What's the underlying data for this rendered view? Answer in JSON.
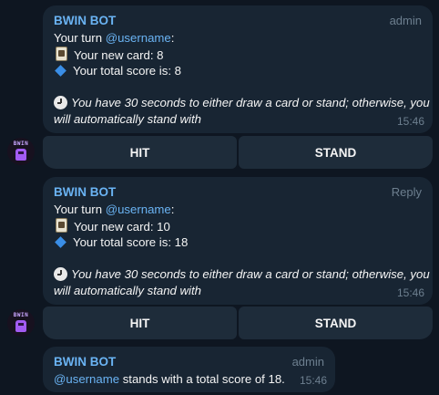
{
  "messages": [
    {
      "sender": "BWIN BOT",
      "role": "admin",
      "turn_prefix": "Your turn ",
      "mention": "@username",
      "turn_suffix": ":",
      "card_line": "Your new card: 8",
      "score_line": "Your total score is: 8",
      "timer_line1": "You have 30 seconds to either draw a card or stand; otherwise, you",
      "timer_line2": "will automatically stand with",
      "time": "15:46"
    },
    {
      "sender": "BWIN BOT",
      "role": "Reply",
      "turn_prefix": "Your turn ",
      "mention": "@username",
      "turn_suffix": ":",
      "card_line": "Your new card: 10",
      "score_line": "Your total score is: 18",
      "timer_line1": "You have 30 seconds to either draw a card or stand; otherwise, you",
      "timer_line2": "will automatically stand with",
      "time": "15:46"
    },
    {
      "sender": "BWIN BOT",
      "role": "admin",
      "mention": "@username",
      "text": " stands with a total score of 18.",
      "time": "15:46"
    }
  ],
  "keyboard": {
    "hit_label": "HIT",
    "stand_label": "STAND"
  },
  "avatar": {
    "text": "BWIN"
  },
  "colors": {
    "background": "#0e1621",
    "bubble": "#182533",
    "button": "#1e2c3a",
    "accent": "#6ab3f3",
    "meta": "#6d7f8f",
    "avatar_purple": "#a25bf2"
  },
  "icons": {
    "card": "playing-card-icon",
    "diamond": "blue-diamond-icon",
    "timer": "clock-icon"
  }
}
